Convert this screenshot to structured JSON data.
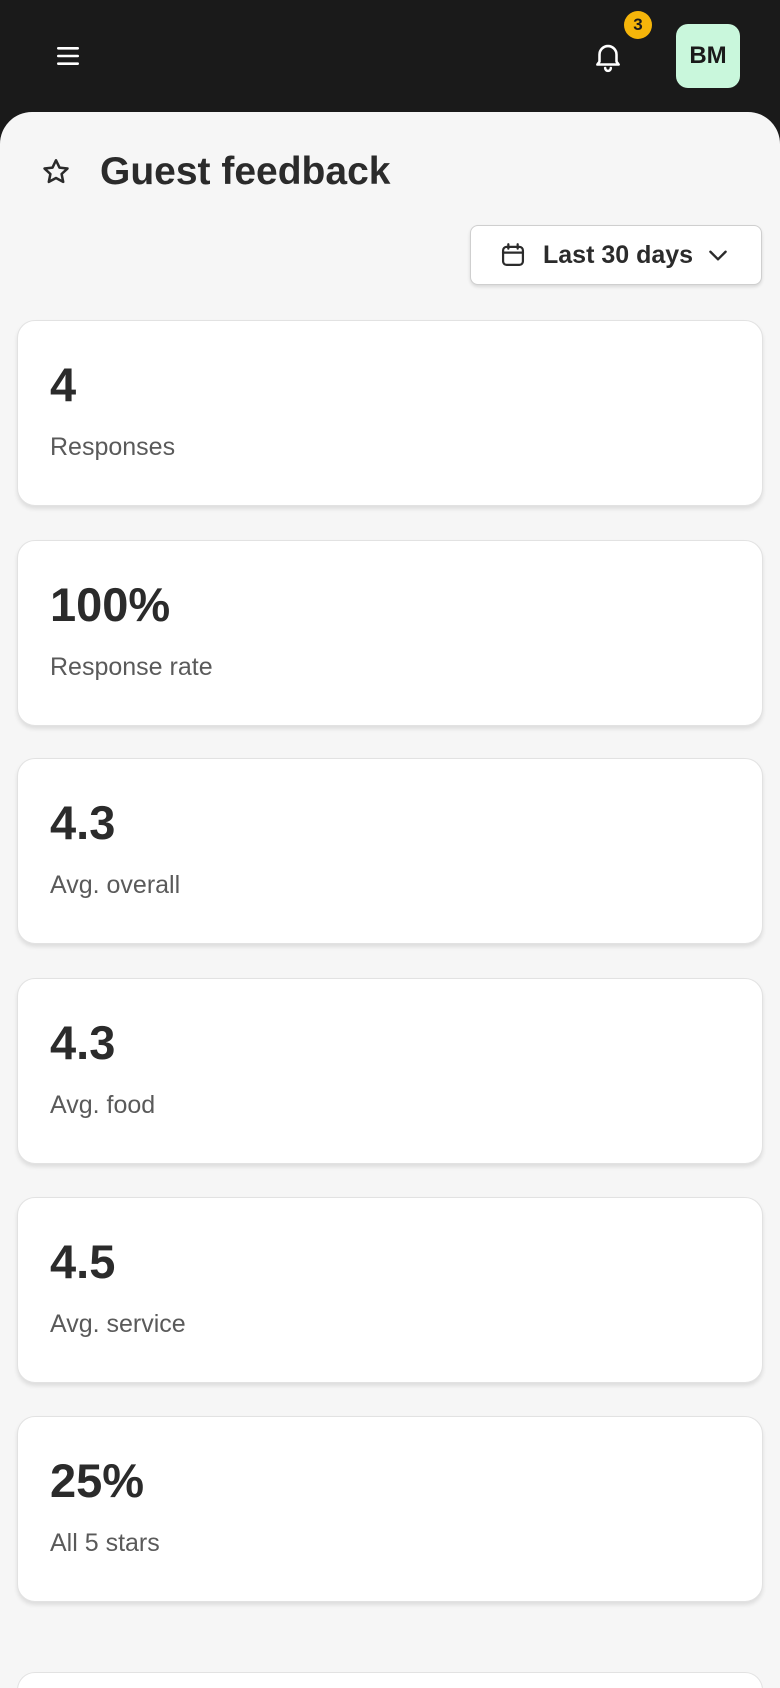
{
  "header": {
    "menu_icon": "hamburger-icon",
    "bell_icon": "bell-icon",
    "notification_count": "3",
    "avatar_initials": "BM",
    "colors": {
      "bar": "#1a1a1a",
      "badge": "#f5b50a",
      "avatar_bg": "#c9f7dc"
    }
  },
  "page": {
    "title": "Guest feedback",
    "title_icon": "star-outline-icon"
  },
  "filter": {
    "range_label": "Last 30 days",
    "calendar_icon": "calendar-icon",
    "chevron_icon": "chevron-down-icon"
  },
  "stats": [
    {
      "value": "4",
      "label": "Responses"
    },
    {
      "value": "100%",
      "label": "Response rate"
    },
    {
      "value": "4.3",
      "label": "Avg. overall"
    },
    {
      "value": "4.3",
      "label": "Avg. food"
    },
    {
      "value": "4.5",
      "label": "Avg. service"
    },
    {
      "value": "25%",
      "label": "All 5 stars"
    }
  ]
}
